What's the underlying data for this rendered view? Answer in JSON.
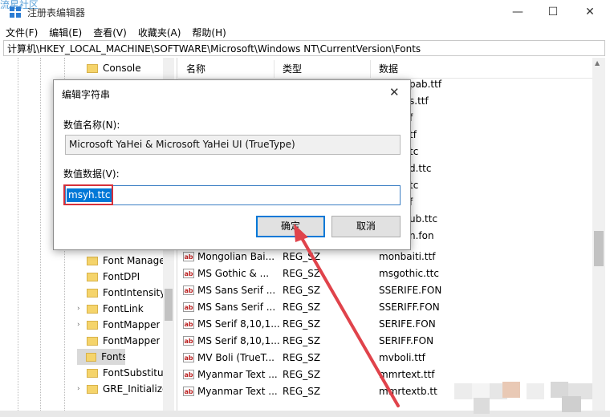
{
  "watermark": "流星社区",
  "window": {
    "title": "注册表编辑器"
  },
  "menu": [
    "文件(F)",
    "编辑(E)",
    "查看(V)",
    "收藏夹(A)",
    "帮助(H)"
  ],
  "address": "计算机\\HKEY_LOCAL_MACHINE\\SOFTWARE\\Microsoft\\Windows NT\\CurrentVersion\\Fonts",
  "tree": {
    "items": [
      {
        "label": "Console",
        "arrow": ""
      },
      {
        "label": "Font Manage",
        "arrow": ""
      },
      {
        "label": "FontDPI",
        "arrow": ""
      },
      {
        "label": "FontIntensity",
        "arrow": ""
      },
      {
        "label": "FontLink",
        "arrow": "›"
      },
      {
        "label": "FontMapper",
        "arrow": "›"
      },
      {
        "label": "FontMapper",
        "arrow": ""
      },
      {
        "label": "Fonts",
        "arrow": ""
      },
      {
        "label": "FontSubstitu",
        "arrow": ""
      },
      {
        "label": "GRE_Initialize",
        "arrow": "›"
      }
    ]
  },
  "list": {
    "columns": [
      "名称",
      "类型",
      "数据"
    ],
    "partial_data": [
      "pab.ttf",
      "s.ttf",
      "f",
      "tf",
      "tc",
      "d.ttc",
      "tc",
      "f",
      "ub.ttc",
      "n.fon"
    ],
    "rows": [
      {
        "name": "Mongolian Bai...",
        "type": "REG_SZ",
        "data": "monbaiti.ttf"
      },
      {
        "name": "MS Gothic & ...",
        "type": "REG_SZ",
        "data": "msgothic.ttc"
      },
      {
        "name": "MS Sans Serif ...",
        "type": "REG_SZ",
        "data": "SSERIFE.FON"
      },
      {
        "name": "MS Sans Serif ...",
        "type": "REG_SZ",
        "data": "SSERIFF.FON"
      },
      {
        "name": "MS Serif 8,10,1...",
        "type": "REG_SZ",
        "data": "SERIFE.FON"
      },
      {
        "name": "MS Serif 8,10,1...",
        "type": "REG_SZ",
        "data": "SERIFF.FON"
      },
      {
        "name": "MV Boli (TrueT...",
        "type": "REG_SZ",
        "data": "mvboli.ttf"
      },
      {
        "name": "Myanmar Text ...",
        "type": "REG_SZ",
        "data": "mmrtext.ttf"
      },
      {
        "name": "Myanmar Text ...",
        "type": "REG_SZ",
        "data": "mmrtextb.tt"
      }
    ],
    "string_icon": "ab"
  },
  "dialog": {
    "title": "编辑字符串",
    "name_label": "数值名称(N):",
    "name_value": "Microsoft YaHei & Microsoft YaHei UI (TrueType)",
    "data_label": "数值数据(V):",
    "data_value": "msyh.ttc",
    "ok": "确定",
    "cancel": "取消"
  },
  "colors": {
    "selection": "#0078d7",
    "highlight_box": "#d6303a",
    "arrow": "#e0434b",
    "folder": "#f5d46b"
  }
}
